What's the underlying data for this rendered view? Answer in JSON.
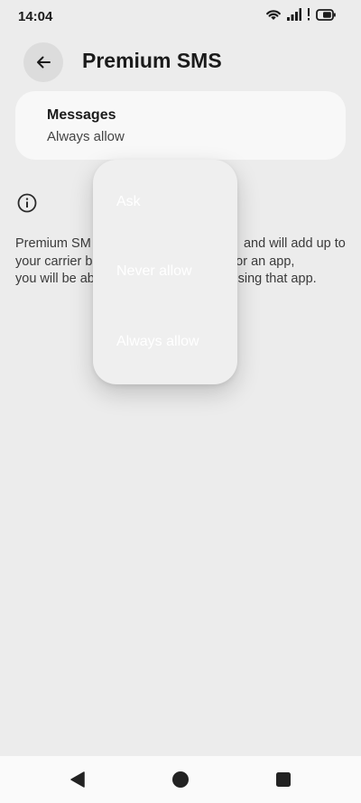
{
  "status_bar": {
    "time": "14:04",
    "icons": [
      "wifi-icon",
      "signal-icon",
      "alert-icon",
      "battery-icon"
    ]
  },
  "header": {
    "back_icon": "arrow-back-icon",
    "title": "Premium SMS"
  },
  "app_item": {
    "name": "Messages",
    "value": "Always allow"
  },
  "info": {
    "icon": "info-icon",
    "text_lines": [
      "Premium SM                                          and will add up to",
      "your carrier b                             ssion for an app,",
      "you will be ab                                  S using that app."
    ]
  },
  "dropdown": {
    "options": [
      "Ask",
      "Never allow",
      "Always allow"
    ]
  },
  "nav_bar": {
    "buttons": [
      "back-triangle-icon",
      "home-circle-icon",
      "recents-square-icon"
    ]
  }
}
